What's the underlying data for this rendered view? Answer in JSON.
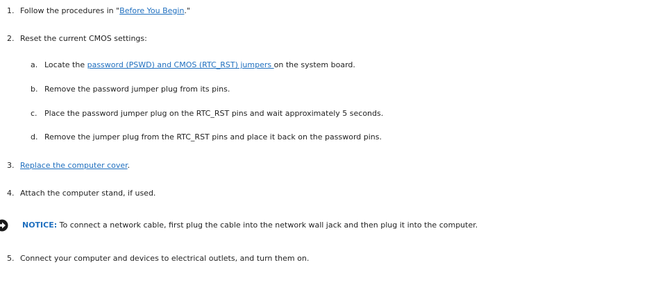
{
  "steps": {
    "s1": {
      "number": "1.",
      "before": "Follow the procedures in \"",
      "link": "Before You Begin",
      "after": ".\""
    },
    "s2": {
      "number": "2.",
      "text": "Reset the current CMOS settings:",
      "substeps": {
        "a": {
          "letter": "a.",
          "before": "Locate the ",
          "link": "password (PSWD) and CMOS (RTC_RST) jumpers ",
          "after": "on the system board."
        },
        "b": {
          "letter": "b.",
          "text": "Remove the password jumper plug from its pins."
        },
        "c": {
          "letter": "c.",
          "text": "Place the password jumper plug on the RTC_RST pins and wait approximately 5 seconds."
        },
        "d": {
          "letter": "d.",
          "text": "Remove the jumper plug from the RTC_RST pins and place it back on the password pins."
        }
      }
    },
    "s3": {
      "number": "3.",
      "link": "Replace the computer cover",
      "after": "."
    },
    "s4": {
      "number": "4.",
      "text": "Attach the computer stand, if used."
    },
    "s5": {
      "number": "5.",
      "text": "Connect your computer and devices to electrical outlets, and turn them on."
    }
  },
  "notice": {
    "label": "NOTICE:",
    "text": " To connect a network cable, first plug the cable into the network wall jack and then plug it into the computer.",
    "icon": "notice-arrow-icon"
  },
  "colors": {
    "link": "#1f6fbf",
    "text": "#222222",
    "notice_label": "#1f6fbf"
  }
}
